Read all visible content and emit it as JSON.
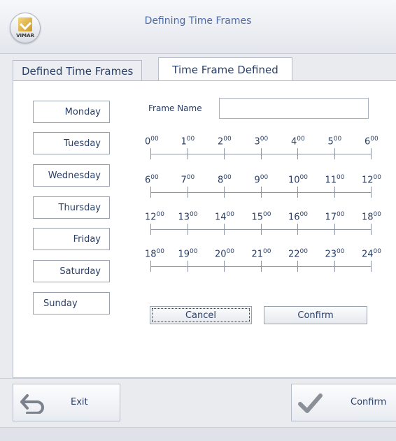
{
  "window": {
    "title": "Defining Time Frames",
    "logo_text": "VIMAR"
  },
  "tabs": [
    {
      "label": "Defined Time Frames",
      "selected": false
    },
    {
      "label": "Time Frame Defined",
      "selected": true
    }
  ],
  "days": [
    "Monday",
    "Tuesday",
    "Wednesday",
    "Thursday",
    "Friday",
    "Saturday",
    "Sunday"
  ],
  "frame_name": {
    "label": "Frame Name",
    "value": ""
  },
  "rulers": [
    [
      "0",
      "1",
      "2",
      "3",
      "4",
      "5",
      "6"
    ],
    [
      "6",
      "7",
      "8",
      "9",
      "10",
      "11",
      "12"
    ],
    [
      "12",
      "13",
      "14",
      "15",
      "16",
      "17",
      "18"
    ],
    [
      "18",
      "19",
      "20",
      "21",
      "22",
      "23",
      "24"
    ]
  ],
  "minutes_sup": "00",
  "actions": {
    "cancel": "Cancel",
    "confirm": "Confirm"
  },
  "footer": {
    "exit": "Exit",
    "confirm": "Confirm"
  },
  "colors": {
    "text": "#2a3f66",
    "title": "#4d6aa8",
    "confirm_check": "#8a8f98"
  }
}
